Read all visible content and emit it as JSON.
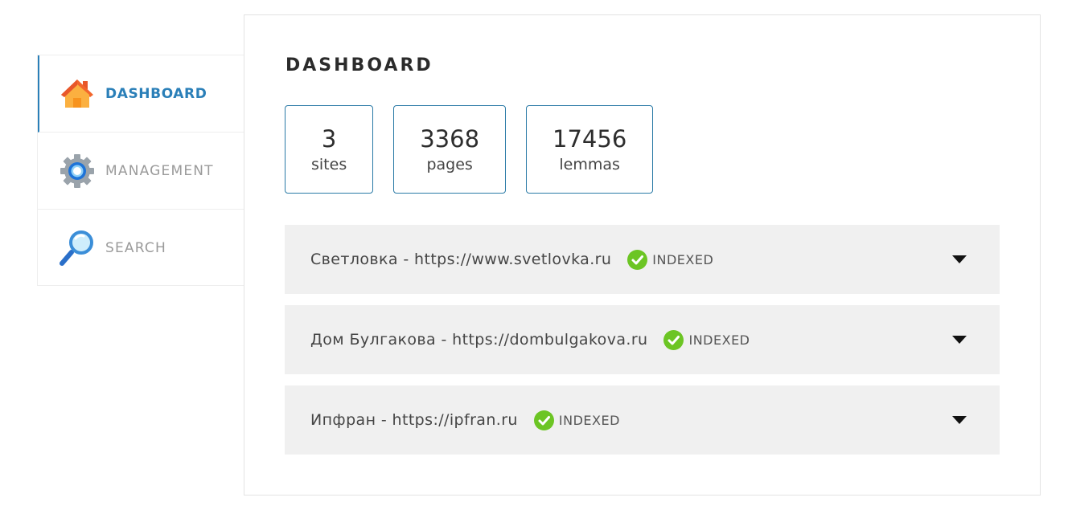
{
  "sidebar": {
    "items": [
      {
        "label": "DASHBOARD",
        "icon": "home-icon",
        "active": true
      },
      {
        "label": "MANAGEMENT",
        "icon": "gear-icon",
        "active": false
      },
      {
        "label": "SEARCH",
        "icon": "magnifier-icon",
        "active": false
      }
    ]
  },
  "main": {
    "title": "DASHBOARD",
    "stats": [
      {
        "value": "3",
        "label": "sites"
      },
      {
        "value": "3368",
        "label": "pages"
      },
      {
        "value": "17456",
        "label": "lemmas"
      }
    ],
    "sites": [
      {
        "name": "Светловка - https://www.svetlovka.ru",
        "status": "INDEXED"
      },
      {
        "name": "Дом Булгакова - https://dombulgakova.ru",
        "status": "INDEXED"
      },
      {
        "name": "Ипфран - https://ipfran.ru",
        "status": "INDEXED"
      }
    ]
  },
  "colors": {
    "accent": "#2a7fb8",
    "status_ok": "#6cc524",
    "row_bg": "#f0f0f0"
  }
}
